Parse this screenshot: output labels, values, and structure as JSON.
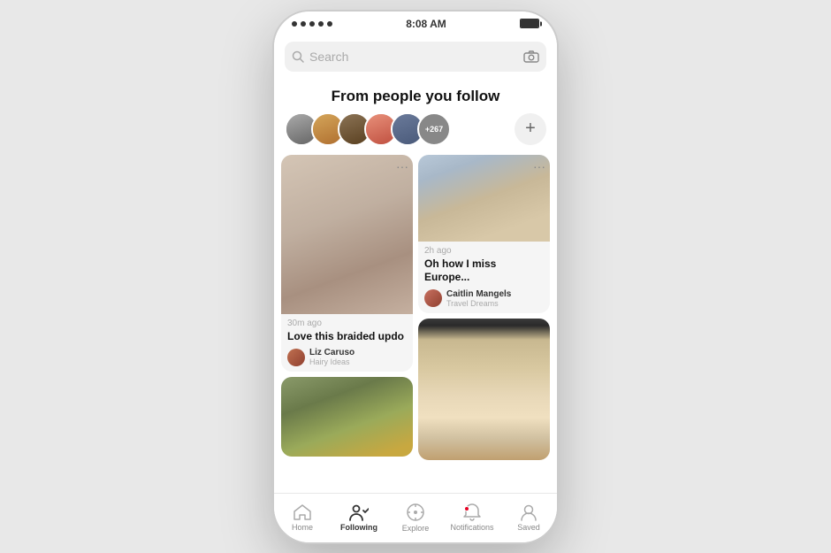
{
  "statusBar": {
    "time": "8:08 AM",
    "dots": 5
  },
  "search": {
    "placeholder": "Search"
  },
  "followingSection": {
    "title": "From people you follow",
    "avatarCount": "+267",
    "addLabel": "+"
  },
  "pins": {
    "left": [
      {
        "imageType": "braid",
        "time": "30m ago",
        "title": "Love this braided updo",
        "authorName": "Liz Caruso",
        "boardName": "Hairy Ideas"
      },
      {
        "imageType": "brussels",
        "time": "",
        "title": "",
        "authorName": "",
        "boardName": ""
      }
    ],
    "right": [
      {
        "imageType": "europe",
        "time": "2h ago",
        "title": "Oh how I miss Europe...",
        "authorName": "Caitlin Mangels",
        "boardName": "Travel Dreams"
      },
      {
        "imageType": "dining",
        "time": "",
        "title": "",
        "authorName": "",
        "boardName": ""
      }
    ]
  },
  "bottomNav": {
    "items": [
      {
        "id": "home",
        "label": "Home",
        "active": false
      },
      {
        "id": "following",
        "label": "Following",
        "active": true
      },
      {
        "id": "explore",
        "label": "Explore",
        "active": false
      },
      {
        "id": "notifications",
        "label": "Notifications",
        "active": false
      },
      {
        "id": "saved",
        "label": "Saved",
        "active": false
      }
    ]
  }
}
